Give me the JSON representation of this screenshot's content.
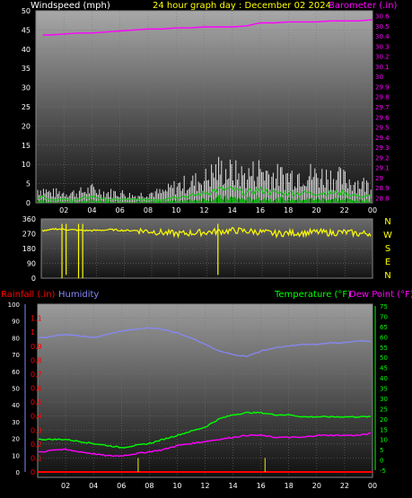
{
  "colors": {
    "windspeed": "#ffffff",
    "gust": "#ffffff",
    "avg_wind": "#00cc00",
    "barometer": "#ff00ff",
    "direction": "#ffff00",
    "rainfall": "#ff0000",
    "humidity": "#8888ff",
    "temperature": "#00ff00",
    "dewpoint": "#ff00ff",
    "rain_bar": "#cccc00",
    "title": "#ffff00",
    "axis_text": "#ffffff",
    "ns_text": "#ffff00"
  },
  "chart_data": [
    {
      "type": "line",
      "title": "24 hour graph day : December 02 2024",
      "ylabel": "Windspeed (mph)",
      "y2label": "Barometer (.in)",
      "x_ticks": [
        "02",
        "04",
        "06",
        "08",
        "10",
        "12",
        "14",
        "16",
        "18",
        "20",
        "22",
        "00"
      ],
      "ylim": [
        0,
        50
      ],
      "yticks": [
        0,
        5,
        10,
        15,
        20,
        25,
        30,
        35,
        40,
        45,
        50
      ],
      "y2lim": [
        28.75,
        30.65
      ],
      "y2ticks": [
        "28.8",
        "28.9",
        "29",
        "29.1",
        "29.2",
        "29.3",
        "29.4",
        "29.5",
        "29.6",
        "29.7",
        "29.8",
        "29.9",
        "30",
        "30.1",
        "30.2",
        "30.3",
        "30.4",
        "30.5",
        "30.6"
      ],
      "grid": true,
      "series": [
        {
          "key": "barometer",
          "axis": "y2",
          "x": [
            0.5,
            1,
            2,
            3,
            4,
            5,
            6,
            7,
            8,
            9,
            10,
            11,
            12,
            13,
            14,
            15,
            16,
            17,
            18,
            19,
            20,
            21,
            22,
            23,
            24
          ],
          "values": [
            30.41,
            30.41,
            30.42,
            30.43,
            30.43,
            30.44,
            30.45,
            30.46,
            30.47,
            30.47,
            30.48,
            30.48,
            30.49,
            30.49,
            30.49,
            30.5,
            30.53,
            30.53,
            30.54,
            30.54,
            30.54,
            30.55,
            30.55,
            30.55,
            30.56
          ]
        },
        {
          "key": "windspeed",
          "axis": "y",
          "x": [
            0.5,
            1,
            2,
            3,
            4,
            5,
            6,
            7,
            8,
            9,
            10,
            11,
            12,
            13,
            14,
            15,
            16,
            17,
            18,
            19,
            20,
            21,
            22,
            23,
            24
          ],
          "values": [
            2,
            1,
            1,
            1,
            2,
            1,
            1,
            1,
            1,
            1,
            2,
            2,
            3,
            4,
            4,
            3,
            4,
            3,
            3,
            3,
            3,
            3,
            3,
            2,
            2
          ]
        },
        {
          "key": "gust",
          "axis": "y",
          "x": [
            0.5,
            1,
            2,
            3,
            4,
            5,
            6,
            7,
            8,
            9,
            10,
            11,
            12,
            13,
            14,
            15,
            16,
            17,
            18,
            19,
            20,
            21,
            22,
            23,
            24
          ],
          "values": [
            4,
            3,
            3,
            3,
            4,
            3,
            3,
            2,
            3,
            3,
            5,
            6,
            7,
            10,
            9,
            8,
            10,
            8,
            8,
            9,
            8,
            8,
            7,
            6,
            5
          ]
        }
      ]
    },
    {
      "type": "scatter",
      "ylabel": "",
      "yticks": [
        0,
        90,
        180,
        270,
        360
      ],
      "ylim": [
        0,
        360
      ],
      "compass": [
        "N",
        "W",
        "S",
        "E",
        "N"
      ],
      "grid": true,
      "series": [
        {
          "key": "direction",
          "x": [
            0.5,
            1,
            2,
            3,
            4,
            5,
            6,
            7,
            8,
            9,
            10,
            11,
            12,
            13,
            14,
            15,
            16,
            17,
            18,
            19,
            20,
            21,
            22,
            23,
            24
          ],
          "values": [
            290,
            300,
            295,
            290,
            290,
            295,
            290,
            290,
            285,
            275,
            270,
            275,
            280,
            285,
            290,
            285,
            280,
            270,
            275,
            275,
            280,
            275,
            280,
            270,
            275
          ]
        }
      ]
    },
    {
      "type": "line",
      "ylabel": "Rainfall (.in)",
      "ylabel2": "Humidity",
      "y3label": "Temperature (°F)",
      "y4label": "Dew Point (°F)",
      "x_ticks": [
        "02",
        "04",
        "06",
        "08",
        "10",
        "12",
        "14",
        "16",
        "18",
        "20",
        "22",
        "00"
      ],
      "rain_ticks": [
        "0",
        "0.1",
        "0.2",
        "0.3",
        "0.4",
        "0.5",
        "0.6",
        "0.7",
        "0.8",
        "0.9",
        "1",
        "1.1"
      ],
      "hum_ticks": [
        0,
        10,
        20,
        30,
        40,
        50,
        60,
        70,
        80,
        90,
        100
      ],
      "temp_ticks": [
        -5,
        0,
        5,
        10,
        15,
        20,
        25,
        30,
        35,
        40,
        45,
        50,
        55,
        60,
        65,
        70,
        75
      ],
      "grid": true,
      "series": [
        {
          "key": "humidity",
          "x": [
            0.5,
            1,
            2,
            3,
            4,
            5,
            6,
            7,
            8,
            9,
            10,
            11,
            12,
            13,
            14,
            15,
            16,
            17,
            18,
            19,
            20,
            21,
            22,
            23,
            24
          ],
          "values": [
            80,
            81,
            82,
            81,
            80,
            82,
            84,
            85,
            86,
            85,
            83,
            80,
            76,
            72,
            70,
            69,
            72,
            74,
            75,
            76,
            76,
            77,
            77,
            78,
            78
          ]
        },
        {
          "key": "temperature",
          "x": [
            0.5,
            1,
            2,
            3,
            4,
            5,
            6,
            7,
            8,
            9,
            10,
            11,
            12,
            13,
            14,
            15,
            16,
            17,
            18,
            19,
            20,
            21,
            22,
            23,
            24
          ],
          "values": [
            10,
            10,
            10,
            9,
            8,
            7,
            6,
            7,
            8,
            10,
            12,
            14,
            16,
            20,
            22,
            23,
            23,
            22,
            22,
            21,
            21,
            21,
            21,
            21,
            21
          ]
        },
        {
          "key": "dewpoint",
          "x": [
            0.5,
            1,
            2,
            3,
            4,
            5,
            6,
            7,
            8,
            9,
            10,
            11,
            12,
            13,
            14,
            15,
            16,
            17,
            18,
            19,
            20,
            21,
            22,
            23,
            24
          ],
          "values": [
            4,
            5,
            5,
            4,
            3,
            2,
            2,
            3,
            4,
            5,
            7,
            8,
            9,
            10,
            11,
            12,
            12,
            11,
            11,
            11,
            12,
            12,
            12,
            12,
            13
          ]
        },
        {
          "key": "rainfall",
          "x": [
            0.5,
            24
          ],
          "values": [
            0,
            0
          ]
        }
      ]
    }
  ]
}
